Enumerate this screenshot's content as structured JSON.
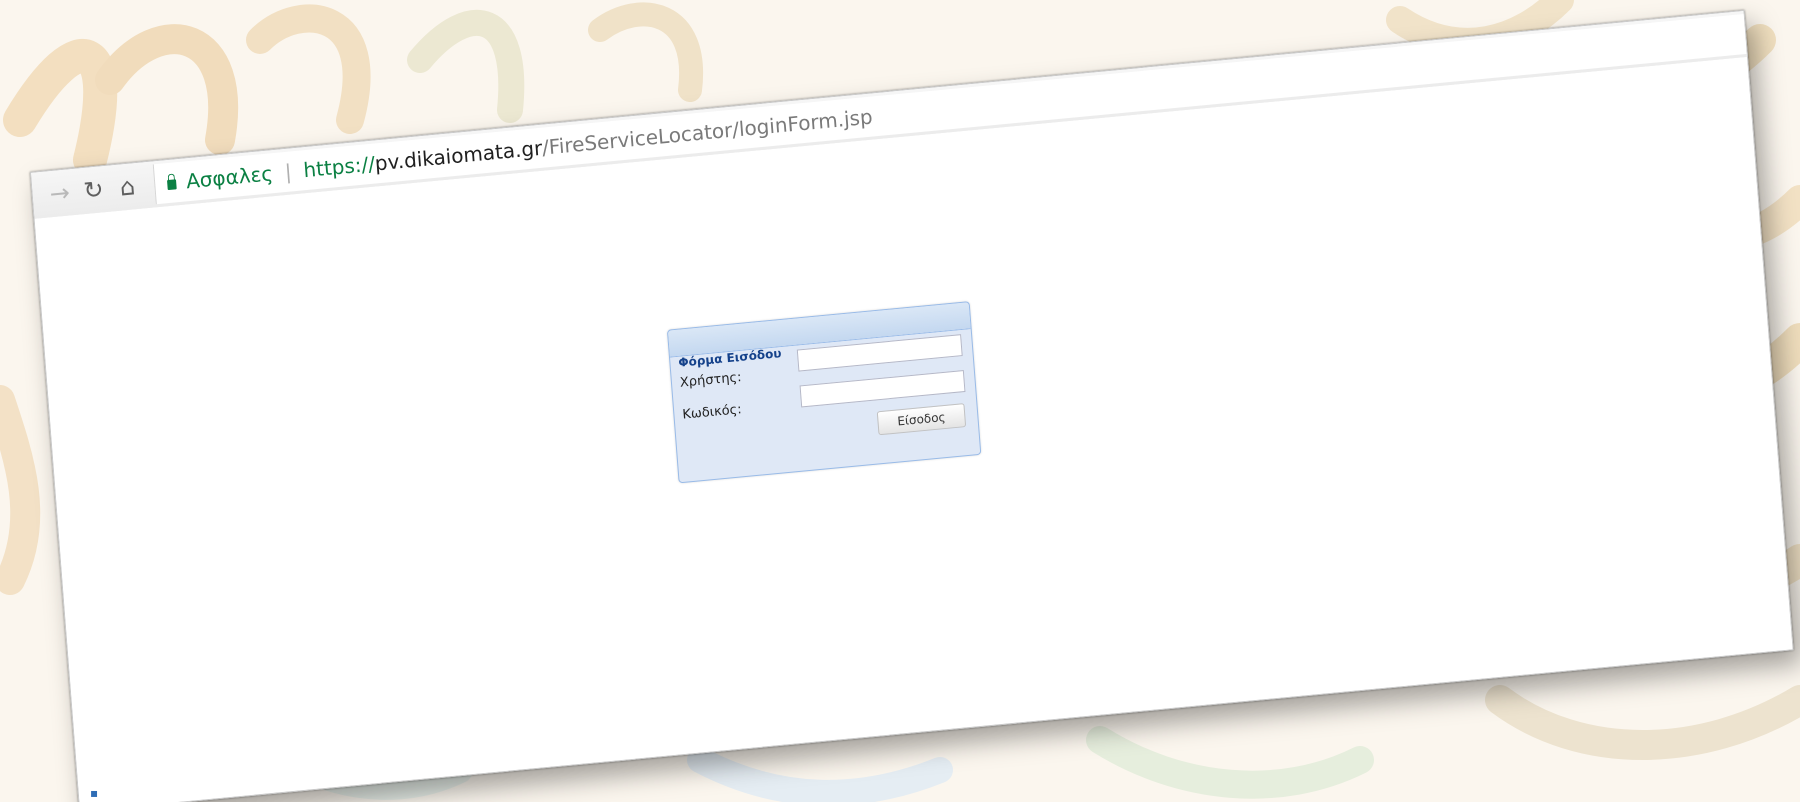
{
  "browser": {
    "secure_label": "Ασφαλες",
    "separator": "|",
    "url_scheme": "https://",
    "url_host": "pv.dikaiomata.gr",
    "url_path": "/FireServiceLocator/loginForm.jsp"
  },
  "login": {
    "title": "Φόρμα Εισόδου",
    "username_label": "Χρήστης:",
    "password_label": "Κωδικός:",
    "username_value": "",
    "password_value": "",
    "submit_label": "Είσοδος"
  },
  "colors": {
    "secure_green": "#0b8043",
    "panel_bg": "#dfe8f6",
    "panel_border": "#99bbe8",
    "panel_title": "#15428b"
  },
  "icons": {
    "back": "arrow-right-icon",
    "reload": "reload-icon",
    "home": "home-icon",
    "lock": "lock-icon"
  }
}
